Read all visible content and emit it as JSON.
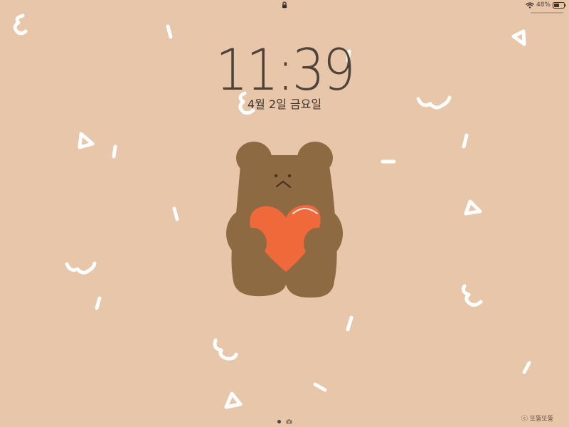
{
  "status_bar": {
    "battery_percent": "48%",
    "icons": [
      "lock-icon",
      "wifi-icon",
      "battery-icon"
    ]
  },
  "lock_screen": {
    "time": "11:39",
    "date": "4월 2일 금요일"
  },
  "wallpaper": {
    "background_color": "#E8C6A9",
    "bear_color": "#8E6A43",
    "heart_color": "#F0693A",
    "doodle_color": "#FFFFFF",
    "watermark": "ⓒ 또뚱또뚱"
  },
  "page_indicator": {
    "icons": [
      "page-dot-icon",
      "camera-icon"
    ]
  }
}
